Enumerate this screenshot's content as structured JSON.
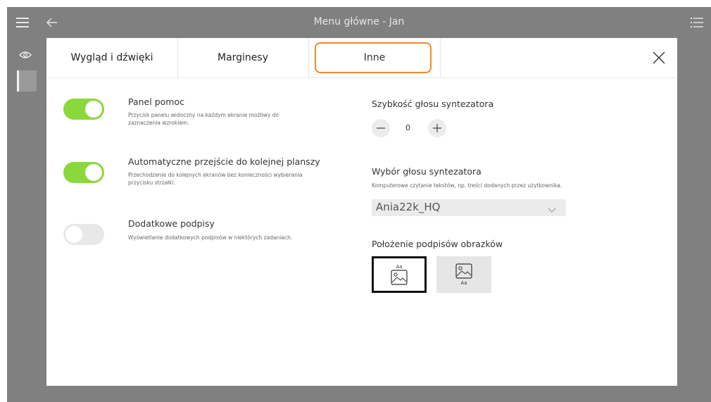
{
  "titlebar": {
    "title": "Menu główne - Jan"
  },
  "tabs": [
    {
      "label": "Wygląd i dźwięki"
    },
    {
      "label": "Marginesy"
    },
    {
      "label": "Inne"
    }
  ],
  "active_tab": "Inne",
  "settings_left": [
    {
      "title": "Panel pomoc",
      "desc": "Przycisk panelu widoczny na każdym ekranie możliwy do zaznaczenia wzrokiem.",
      "enabled": true
    },
    {
      "title": "Automatyczne przejście do kolejnej planszy",
      "desc": "Przechodzenie do kolejnych ekranów bez konieczności wybierania przycisku strzałki.",
      "enabled": true
    },
    {
      "title": "Dodatkowe podpisy",
      "desc": "Wyświetlanie dodatkowych podpisów w niektórych zadaniach.",
      "enabled": false
    }
  ],
  "speech_rate": {
    "title": "Szybkość głosu syntezatora",
    "value": "0"
  },
  "voice": {
    "title": "Wybór głosu syntezatora",
    "desc": "Komputerowe czytanie tekstów, np. treści dodanych przez użytkownika.",
    "selected": "Ania22k_HQ"
  },
  "caption_position": {
    "title": "Położenie podpisów obrazków",
    "options": [
      {
        "label": "Aa",
        "placement": "top",
        "selected": true
      },
      {
        "label": "Aa",
        "placement": "bottom",
        "selected": false
      }
    ]
  },
  "colors": {
    "accent_outline": "#ef8a2e",
    "toggle_on": "#8ad83c",
    "frame": "#808080"
  }
}
